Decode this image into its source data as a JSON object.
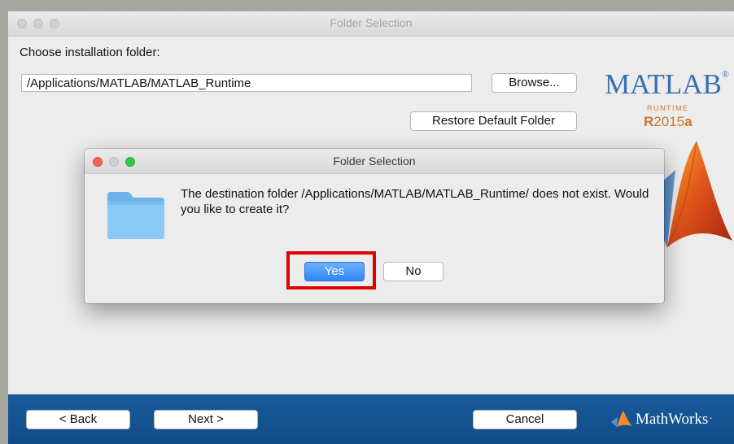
{
  "window": {
    "title": "Folder Selection",
    "choose_label": "Choose installation folder:",
    "path_value": "/Applications/MATLAB/MATLAB_Runtime",
    "browse_label": "Browse...",
    "restore_label": "Restore Default Folder"
  },
  "logo": {
    "name": "MATLAB",
    "registered": "®",
    "subtitle": "RUNTIME",
    "release_r": "R",
    "release_year": "2015",
    "release_letter": "a"
  },
  "dialog": {
    "title": "Folder Selection",
    "message": "The destination folder /Applications/MATLAB/MATLAB_Runtime/ does not exist. Would you like to create it?",
    "yes_label": "Yes",
    "no_label": "No"
  },
  "footer": {
    "back_label": "< Back",
    "next_label": "Next >",
    "cancel_label": "Cancel",
    "brand": "MathWorks",
    "brand_mark": "·"
  },
  "colors": {
    "accent_blue": "#2f86f6",
    "footer_blue": "#155896",
    "highlight_red": "#e00000",
    "close_red": "#fc605c",
    "minimize_yellow": "#fdbc40",
    "zoom_green": "#34c84a"
  }
}
